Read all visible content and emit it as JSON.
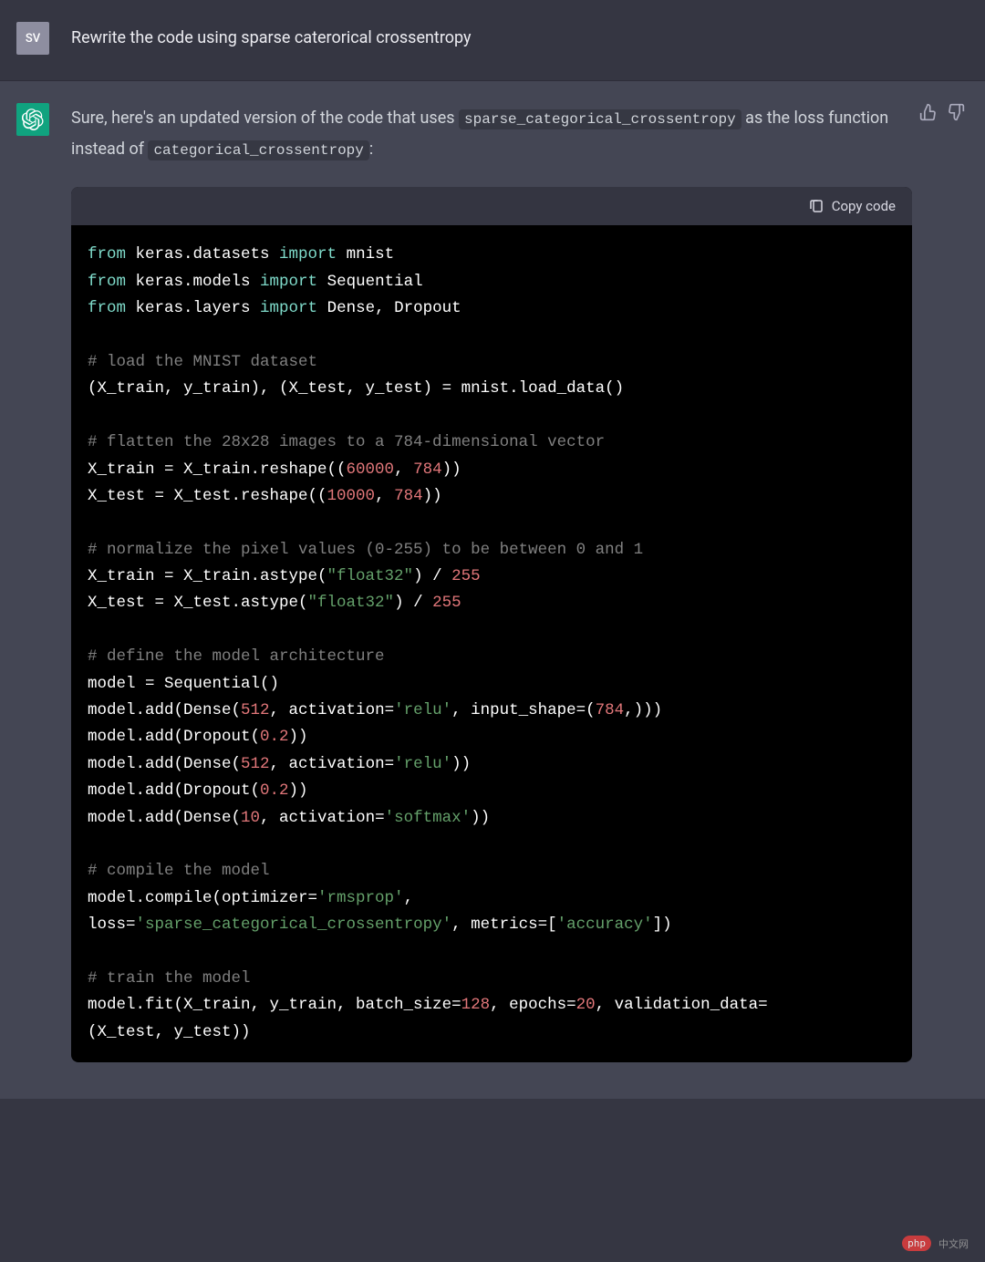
{
  "user": {
    "avatar_text": "SV",
    "prompt": "Rewrite the code using sparse caterorical crossentropy"
  },
  "assistant": {
    "intro_1": "Sure, here's an updated version of the code that uses ",
    "code_inline_1": "sparse_categorical_crossentropy",
    "intro_2": " as the loss function instead of ",
    "code_inline_2": "categorical_crossentropy",
    "intro_3": ":"
  },
  "copy_label": "Copy code",
  "code": {
    "l1_kw1": "from",
    "l1_mod1": " keras.datasets ",
    "l1_kw2": "import",
    "l1_mod2": " mnist",
    "l2_kw1": "from",
    "l2_mod1": " keras.models ",
    "l2_kw2": "import",
    "l2_mod2": " Sequential",
    "l3_kw1": "from",
    "l3_mod1": " keras.layers ",
    "l3_kw2": "import",
    "l3_mod2": " Dense, Dropout",
    "c1": "# load the MNIST dataset",
    "l5": "(X_train, y_train), (X_test, y_test) = mnist.load_data()",
    "c2": "# flatten the 28x28 images to a 784-dimensional vector",
    "l7a": "X_train = X_train.reshape((",
    "l7n1": "60000",
    "l7b": ", ",
    "l7n2": "784",
    "l7c": "))",
    "l8a": "X_test = X_test.reshape((",
    "l8n1": "10000",
    "l8b": ", ",
    "l8n2": "784",
    "l8c": "))",
    "c3": "# normalize the pixel values (0-255) to be between 0 and 1",
    "l10a": "X_train = X_train.astype(",
    "l10s": "\"float32\"",
    "l10b": ") / ",
    "l10n": "255",
    "l11a": "X_test = X_test.astype(",
    "l11s": "\"float32\"",
    "l11b": ") / ",
    "l11n": "255",
    "c4": "# define the model architecture",
    "l13": "model = Sequential()",
    "l14a": "model.add(Dense(",
    "l14n1": "512",
    "l14b": ", activation=",
    "l14s": "'relu'",
    "l14c": ", input_shape=(",
    "l14n2": "784",
    "l14d": ",)))",
    "l15a": "model.add(Dropout(",
    "l15n": "0.2",
    "l15b": "))",
    "l16a": "model.add(Dense(",
    "l16n": "512",
    "l16b": ", activation=",
    "l16s": "'relu'",
    "l16c": "))",
    "l17a": "model.add(Dropout(",
    "l17n": "0.2",
    "l17b": "))",
    "l18a": "model.add(Dense(",
    "l18n": "10",
    "l18b": ", activation=",
    "l18s": "'softmax'",
    "l18c": "))",
    "c5": "# compile the model",
    "l20a": "model.compile(optimizer=",
    "l20s1": "'rmsprop'",
    "l20b": ",",
    "l21a": "loss=",
    "l21s1": "'sparse_categorical_crossentropy'",
    "l21b": ", metrics=[",
    "l21s2": "'accuracy'",
    "l21c": "])",
    "c6": "# train the model",
    "l23a": "model.fit(X_train, y_train, batch_size=",
    "l23n1": "128",
    "l23b": ", epochs=",
    "l23n2": "20",
    "l23c": ", validation_data=",
    "l24": "(X_test, y_test))"
  },
  "watermark": {
    "badge": "php",
    "text": "中文网"
  }
}
